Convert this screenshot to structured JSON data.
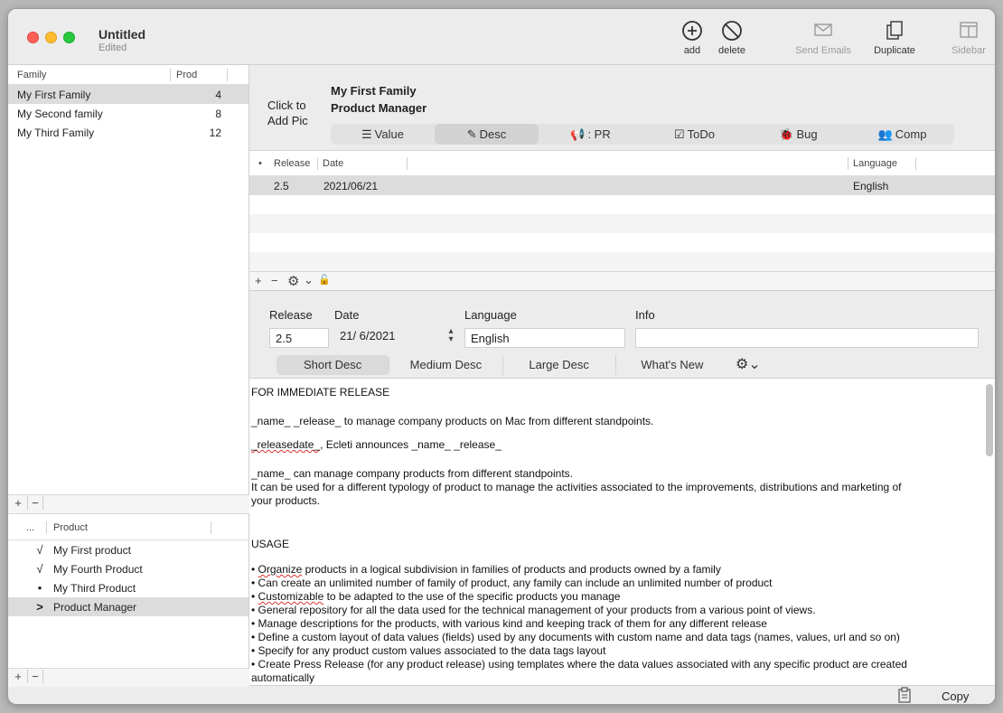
{
  "window": {
    "title": "Untitled",
    "subtitle": "Edited",
    "traffic_lights": {
      "close_color": "#fe5f57",
      "minimize_color": "#febc2e",
      "zoom_color": "#28c840"
    }
  },
  "toolbar": {
    "add_label": "add",
    "delete_label": "delete",
    "send_emails_label": "Send Emails",
    "duplicate_label": "Duplicate",
    "sidebar_label": "Sidebar"
  },
  "families": {
    "columns": {
      "family": "Family",
      "prod": "Prod"
    },
    "rows": [
      {
        "name": "My First Family",
        "count": "4"
      },
      {
        "name": "My Second family",
        "count": "8"
      },
      {
        "name": "My Third Family",
        "count": "12"
      }
    ],
    "add_label": "+",
    "remove_label": "−"
  },
  "products": {
    "columns": {
      "mark": "...",
      "product": "Product"
    },
    "rows": [
      {
        "mark": "√",
        "name": "My First product"
      },
      {
        "mark": "√",
        "name": "My Fourth Product"
      },
      {
        "mark": "•",
        "name": "My Third Product"
      },
      {
        "mark": ">",
        "name": "Product Manager"
      }
    ],
    "add_label": "+",
    "remove_label": "−"
  },
  "product_header": {
    "click_to_add_pic": "Click to Add Pic",
    "family": "My First Family",
    "name": "Product Manager"
  },
  "tabs": [
    {
      "icon": "☰",
      "label": "Value"
    },
    {
      "icon": "✎",
      "label": "Desc"
    },
    {
      "icon": "📢",
      "label": ": PR"
    },
    {
      "icon": "☑",
      "label": "ToDo"
    },
    {
      "icon": "🐞",
      "label": "Bug"
    },
    {
      "icon": "👥",
      "label": "Comp"
    }
  ],
  "releases": {
    "columns": {
      "dot": "•",
      "release": "Release",
      "date": "Date",
      "language": "Language"
    },
    "rows": [
      {
        "release": "2.5",
        "date": "2021/06/21",
        "language": "English"
      }
    ],
    "bar": {
      "add": "+",
      "remove": "−",
      "gear": "⚙",
      "caret": "⌄",
      "lock": "🔓"
    }
  },
  "release_form": {
    "release_label": "Release",
    "date_label": "Date",
    "language_label": "Language",
    "info_label": "Info",
    "release_value": "2.5",
    "date_value": "21/ 6/2021",
    "language_value": "English",
    "info_value": ""
  },
  "desc_tabs": [
    "Short Desc",
    "Medium Desc",
    "Large Desc",
    "What's New"
  ],
  "text_lines": [
    {
      "text": "FOR IMMEDIATE RELEASE"
    },
    {
      "text": "_name_ _release_ to manage company products on Mac from different standpoints."
    },
    {
      "text_a": "_releasedate_",
      "text_b": ", Ecleti announces _name_ _release_"
    },
    {
      "text": "_name_ can manage company products from different standpoints."
    },
    {
      "text": "It can be used for a different typology of product to manage the activities associated to the improvements, distributions and marketing of"
    },
    {
      "text": "your products."
    },
    {
      "text": "USAGE"
    },
    {
      "text_a": "• ",
      "text_b": "Organize",
      "text_c": " products in a logical subdivision in families of products and products owned by a family"
    },
    {
      "text": "• Can create an unlimited number of family of product, any family can include an unlimited number of product"
    },
    {
      "text_a": "• ",
      "text_b": "Customizable",
      "text_c": " to be adapted to the use of the specific products you manage"
    },
    {
      "text": "• General repository for all the data used for the technical management of your products from a various point of views."
    },
    {
      "text": "• Manage descriptions for the products, with various kind and keeping track of them for any different release"
    },
    {
      "text": "• Define a custom layout of data values (fields) used by any documents with custom name and data tags (names, values, url and so on)"
    },
    {
      "text": "• Specify for any product custom values associated to the data tags layout"
    },
    {
      "text": "• Create Press Release (for any product release) using templates where the data values associated with any specific product are created"
    },
    {
      "text": "automatically"
    }
  ],
  "status_bar": {
    "copy_label": "Copy"
  }
}
